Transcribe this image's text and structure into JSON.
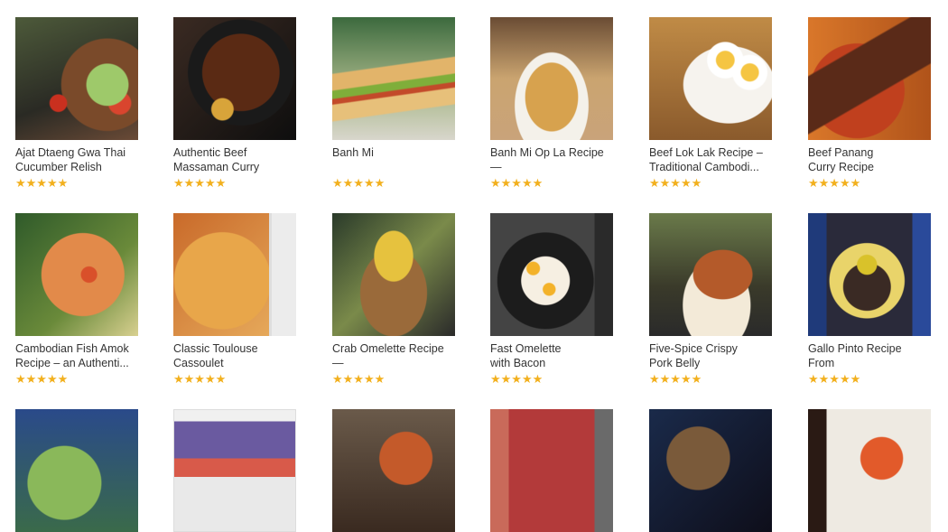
{
  "recipes": [
    {
      "title": "Ajat Dtaeng Gwa Thai\nCucumber Relish",
      "stars": "★★★★★",
      "image": "cucumber-relish-photo"
    },
    {
      "title": "Authentic Beef\nMassaman Curry",
      "stars": "★★★★★",
      "image": "massaman-curry-photo"
    },
    {
      "title": "Banh Mi",
      "stars": "★★★★★",
      "image": "banh-mi-photo"
    },
    {
      "title": "Banh Mi Op La Recipe —\nHoi An Style Banh Mi...",
      "stars": "★★★★★",
      "image": "banh-mi-op-la-photo"
    },
    {
      "title": "Beef Lok Lak Recipe –\nTraditional Cambodi...",
      "stars": "★★★★★",
      "image": "beef-lok-lak-photo"
    },
    {
      "title": "Beef Panang\nCurry Recipe",
      "stars": "★★★★★",
      "image": "beef-panang-photo"
    },
    {
      "title": "Cambodian Fish Amok\nRecipe – an Authenti...",
      "stars": "★★★★★",
      "image": "fish-amok-photo"
    },
    {
      "title": "Classic Toulouse\nCassoulet",
      "stars": "★★★★★",
      "image": "cassoulet-photo"
    },
    {
      "title": "Crab Omelette Recipe —\nWeekend Eggs",
      "stars": "★★★★★",
      "image": "crab-omelette-photo"
    },
    {
      "title": "Fast Omelette\nwith Bacon",
      "stars": "★★★★★",
      "image": "fast-omelette-photo"
    },
    {
      "title": "Five-Spice Crispy\nPork Belly",
      "stars": "★★★★★",
      "image": "pork-belly-photo"
    },
    {
      "title": "Gallo Pinto Recipe From\nCosta Rica",
      "stars": "★★★★★",
      "image": "gallo-pinto-photo"
    }
  ],
  "partial_row_images": [
    "recipe-photo",
    "recipe-photo",
    "recipe-photo",
    "recipe-photo",
    "recipe-photo",
    "recipe-photo"
  ],
  "colors": {
    "star": "#f2b01e",
    "text": "#333333",
    "background": "#ffffff"
  }
}
